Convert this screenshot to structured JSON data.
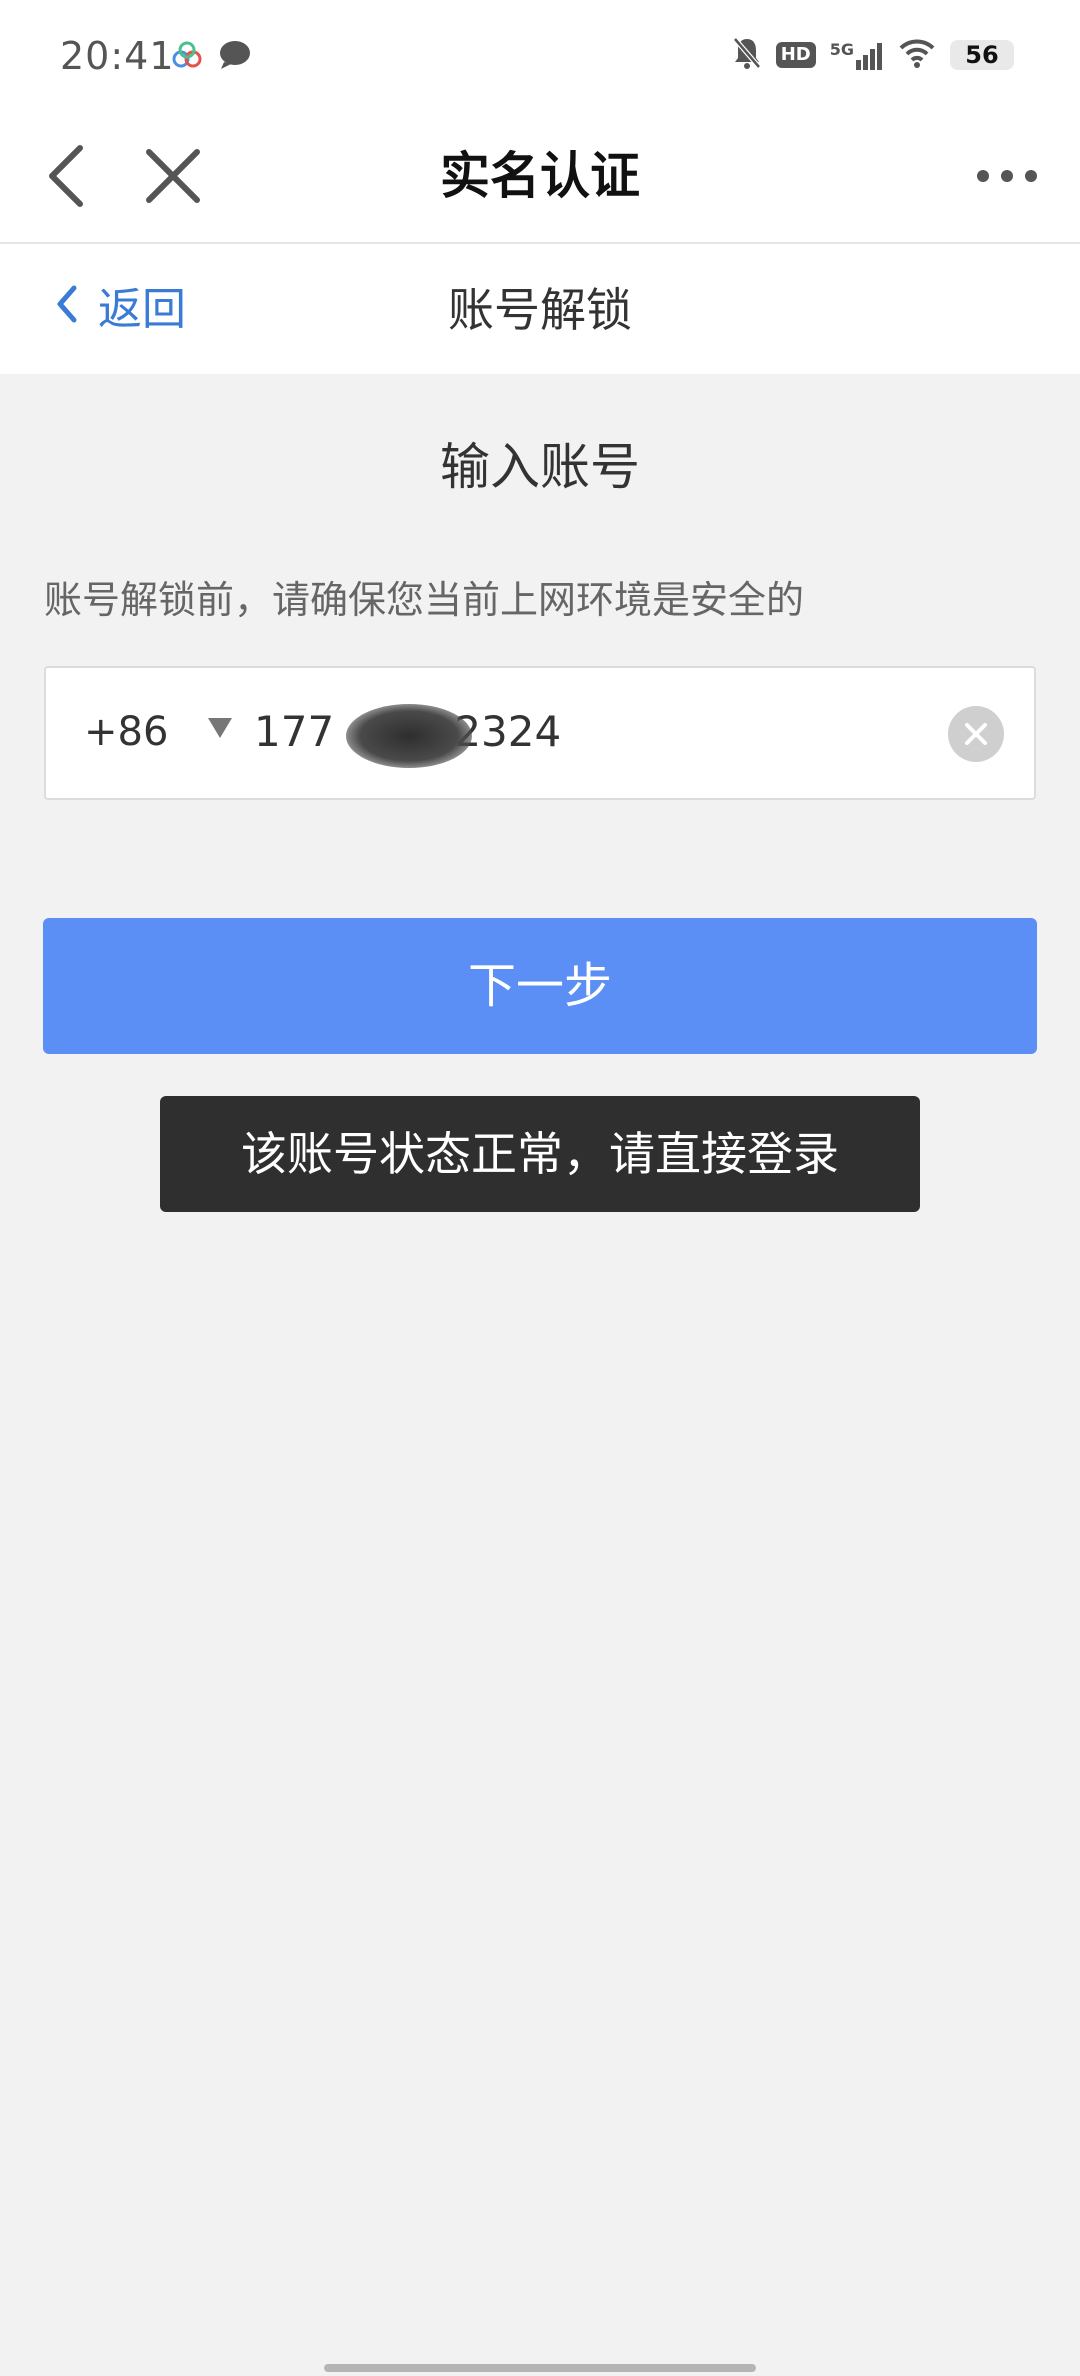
{
  "status_bar": {
    "time": "20:41",
    "network_label": "5G",
    "hd_label": "HD",
    "battery_level": "56",
    "icons": [
      "cloud-app-icon",
      "chat-bubble-icon",
      "mute-bell-icon",
      "hd-icon",
      "signal-5g-icon",
      "wifi-icon",
      "battery-icon"
    ]
  },
  "nav": {
    "title": "实名认证",
    "icons": [
      "back-arrow-icon",
      "close-icon",
      "more-icon"
    ]
  },
  "sub_header": {
    "back_label": "返回",
    "title": "账号解锁"
  },
  "content": {
    "section_title": "输入账号",
    "notice": "账号解锁前，请确保您当前上网环境是安全的",
    "country_code": "+86",
    "phone_value": "177         2324",
    "next_button": "下一步",
    "toast": "该账号状态正常，请直接登录"
  },
  "colors": {
    "accent_blue": "#3a7bd5",
    "button_blue": "#5b8ff5",
    "page_bg": "#f2f2f2",
    "toast_bg": "#2f2f2f"
  }
}
